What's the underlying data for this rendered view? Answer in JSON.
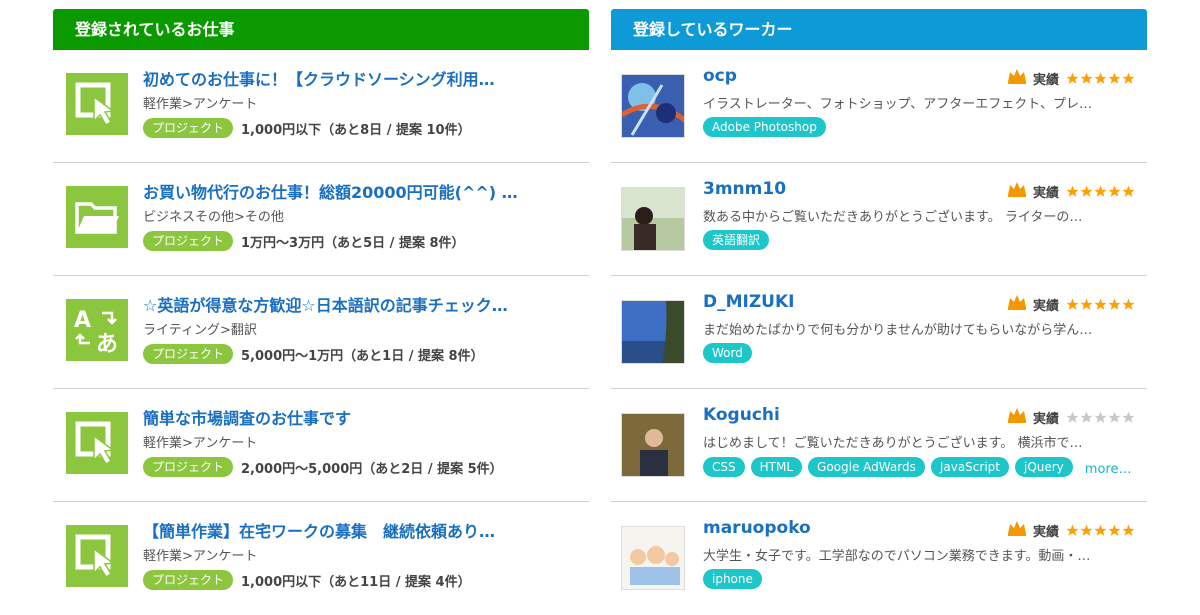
{
  "jobs_panel": {
    "header": "登録されているお仕事",
    "items": [
      {
        "title": "初めてのお仕事に！【クラウドソーシング利用…",
        "category": "軽作業>アンケート",
        "badge": "プロジェクト",
        "price": "1,000円以下（あと8日 / 提案 10件）",
        "icon": "cursor-select-icon"
      },
      {
        "title": "お買い物代行のお仕事！総額20000円可能(^^) …",
        "category": "ビジネスその他>その他",
        "badge": "プロジェクト",
        "price": "1万円〜3万円（あと5日 / 提案 8件）",
        "icon": "folder-icon"
      },
      {
        "title": "☆英語が得意な方歓迎☆日本語訳の記事チェック…",
        "category": "ライティング>翻訳",
        "badge": "プロジェクト",
        "price": "5,000円〜1万円（あと1日 / 提案 8件）",
        "icon": "translate-icon"
      },
      {
        "title": "簡単な市場調査のお仕事です",
        "category": "軽作業>アンケート",
        "badge": "プロジェクト",
        "price": "2,000円〜5,000円（あと2日 / 提案 5件）",
        "icon": "cursor-select-icon"
      },
      {
        "title": "【簡単作業】在宅ワークの募集　継続依頼あり…",
        "category": "軽作業>アンケート",
        "badge": "プロジェクト",
        "price": "1,000円以下（あと11日 / 提案 4件）",
        "icon": "cursor-select-icon"
      }
    ]
  },
  "workers_panel": {
    "header": "登録しているワーカー",
    "rating_label": "実績",
    "more_label": "more…",
    "items": [
      {
        "name": "ocp",
        "desc": "イラストレーター、フォトショップ、アフターエフェクト、プレ…",
        "tags": [
          "Adobe Photoshop"
        ],
        "stars": 5,
        "avatar": "abstract-blue-art"
      },
      {
        "name": "3mnm10",
        "desc": "数ある中からご覧いただきありがとうございます。 ライターの…",
        "tags": [
          "英語翻訳"
        ],
        "stars": 5,
        "avatar": "person-outdoor"
      },
      {
        "name": "D_MIZUKI",
        "desc": "まだ始めたばかりで何も分かりませんが助けてもらいながら学ん…",
        "tags": [
          "Word"
        ],
        "stars": 5,
        "avatar": "sky-tree"
      },
      {
        "name": "Koguchi",
        "desc": "はじめまして！ご覧いただきありがとうございます。 横浜市で…",
        "tags": [
          "CSS",
          "HTML",
          "Google AdWards",
          "JavaScript",
          "jQuery"
        ],
        "stars": 0,
        "more": true,
        "avatar": "man-portrait"
      },
      {
        "name": "maruopoko",
        "desc": "大学生・女子です。工学部なのでパソコン業務できます。動画・…",
        "tags": [
          "iphone"
        ],
        "stars": 5,
        "avatar": "cartoon-family"
      }
    ]
  },
  "colors": {
    "jobs_header": "#0a9a00",
    "workers_header": "#0d9ad6",
    "job_icon": "#8cc63f",
    "tag": "#1cc6c9",
    "star": "#ffa000",
    "link": "#1a6fc0"
  }
}
